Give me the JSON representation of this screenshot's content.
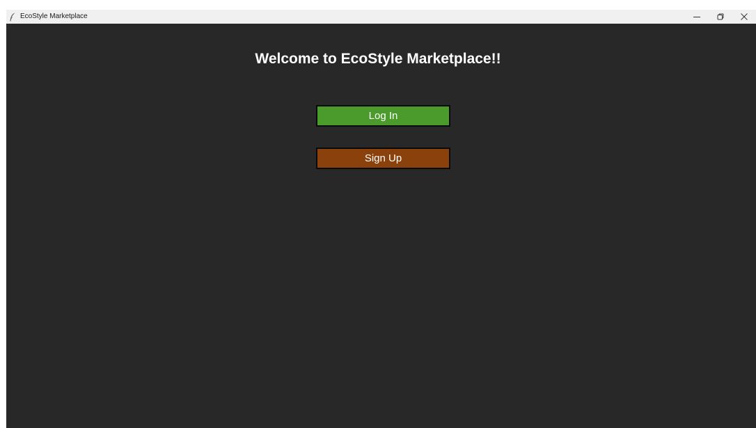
{
  "window": {
    "title": "EcoStyle Marketplace",
    "icon": "feather-icon",
    "controls": [
      "minimize-icon",
      "restore-icon",
      "close-icon"
    ]
  },
  "main": {
    "heading": "Welcome to EcoStyle Marketplace!!",
    "login_label": "Log In",
    "signup_label": "Sign Up"
  },
  "colors": {
    "background": "#282828",
    "login_button": "#4a9a2c",
    "signup_button": "#8a410b",
    "text": "#ffffff"
  }
}
